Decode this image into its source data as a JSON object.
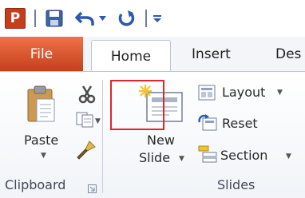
{
  "app": {
    "logo_letter": "P"
  },
  "tabs": {
    "file": "File",
    "home": "Home",
    "insert": "Insert",
    "design_partial": "Des"
  },
  "clipboard": {
    "paste_label": "Paste",
    "group_label": "Clipboard"
  },
  "slides": {
    "new_slide_line1": "New",
    "new_slide_line2": "Slide",
    "layout_label": "Layout",
    "reset_label": "Reset",
    "section_label": "Section",
    "group_label": "Slides"
  },
  "colors": {
    "file_tab": "#e05a2b",
    "highlight_box": "#e0252b",
    "logo_bg": "#c43e1c"
  }
}
